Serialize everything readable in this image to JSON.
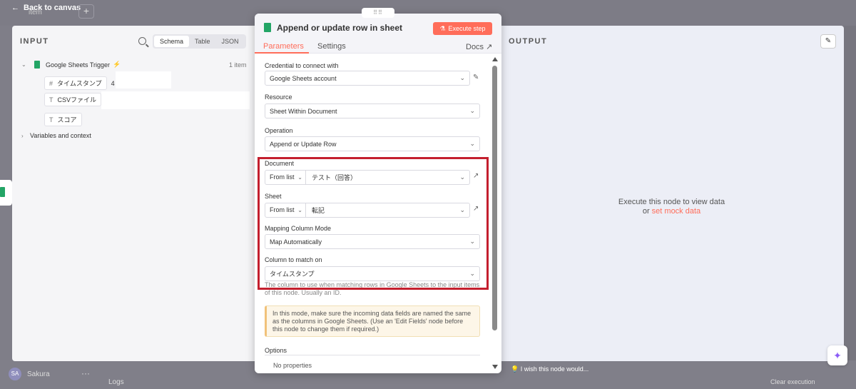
{
  "topbar": {
    "back_label": "Back to canvas",
    "add_label": "+",
    "bg_item": "item"
  },
  "input_panel": {
    "heading": "INPUT",
    "views": [
      "Schema",
      "Table",
      "JSON"
    ],
    "active_view": "Schema",
    "trigger_name": "Google Sheets Trigger",
    "item_count": "1 item",
    "fields": [
      {
        "type": "#",
        "name": "タイムスタンプ",
        "value": "4"
      },
      {
        "type": "T",
        "name": "CSVファイル",
        "value": ""
      },
      {
        "type": "T",
        "name": "スコア",
        "value": ""
      }
    ],
    "variables_label": "Variables and context"
  },
  "modal": {
    "drag_handle": "⠿⠿",
    "title": "Append or update row in sheet",
    "execute_label": "Execute step",
    "tabs": [
      "Parameters",
      "Settings"
    ],
    "docs_label": "Docs",
    "credential_label": "Credential to connect with",
    "credential_value": "Google Sheets account",
    "resource_label": "Resource",
    "resource_value": "Sheet Within Document",
    "operation_label": "Operation",
    "operation_value": "Append or Update Row",
    "document_label": "Document",
    "document_mode": "From list",
    "document_value": "テスト（回答）",
    "sheet_label": "Sheet",
    "sheet_mode": "From list",
    "sheet_value": "転記",
    "mapping_label": "Mapping Column Mode",
    "mapping_value": "Map Automatically",
    "match_label": "Column to match on",
    "match_value": "タイムスタンプ",
    "match_help": "The column to use when matching rows in Google Sheets to the input items of this node. Usually an ID.",
    "notice": "In this mode, make sure the incoming data fields are named the same as the columns in Google Sheets. (Use an 'Edit Fields' node before this node to change them if required.)",
    "options_label": "Options",
    "no_properties": "No properties"
  },
  "output_panel": {
    "heading": "OUTPUT",
    "message": "Execute this node to view data",
    "or_text": "or",
    "mock_link": "set mock data"
  },
  "bottom": {
    "user_initials": "SA",
    "user_name": "Sakura",
    "more": "···",
    "logs_label": "Logs",
    "clear_execution": "Clear execution",
    "wish_label": "I wish this node would..."
  },
  "colors": {
    "accent": "#ff6d5a",
    "sheets_green": "#23a566",
    "highlight_red": "#c41f2e"
  }
}
